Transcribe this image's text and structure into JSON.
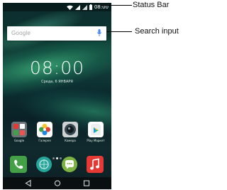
{
  "status_bar": {
    "time": "08:00",
    "icons": [
      "wifi-icon",
      "signal-icon",
      "signal-icon",
      "battery-icon"
    ]
  },
  "search": {
    "logo_text": "Google",
    "icon": "mic-icon"
  },
  "clock": {
    "time": "08:00",
    "date": "Среда, 6 ЯНВАРЯ"
  },
  "apps": [
    {
      "label": "Google",
      "icon": "google-folder-icon"
    },
    {
      "label": "Галерея",
      "icon": "gallery-icon"
    },
    {
      "label": "Камера",
      "icon": "camera-icon"
    },
    {
      "label": "Play Маркет",
      "icon": "play-store-icon"
    }
  ],
  "page_indicator": {
    "count": 3,
    "active": 1
  },
  "dock": [
    {
      "icon": "phone-icon",
      "color": "#43a047"
    },
    {
      "icon": "browser-icon",
      "color": "#26a69a"
    },
    {
      "icon": "messages-icon",
      "color": "#7cb342"
    },
    {
      "icon": "music-icon",
      "color": "#e53935"
    }
  ],
  "nav": [
    "back-icon",
    "home-icon",
    "recents-icon"
  ],
  "annotations": {
    "status_bar": "Status Bar",
    "search_input": "Search input"
  },
  "colors": {
    "wallpaper_dark": "#0b2a2c",
    "aurora": "#50e696",
    "annotation_line": "#000000"
  }
}
